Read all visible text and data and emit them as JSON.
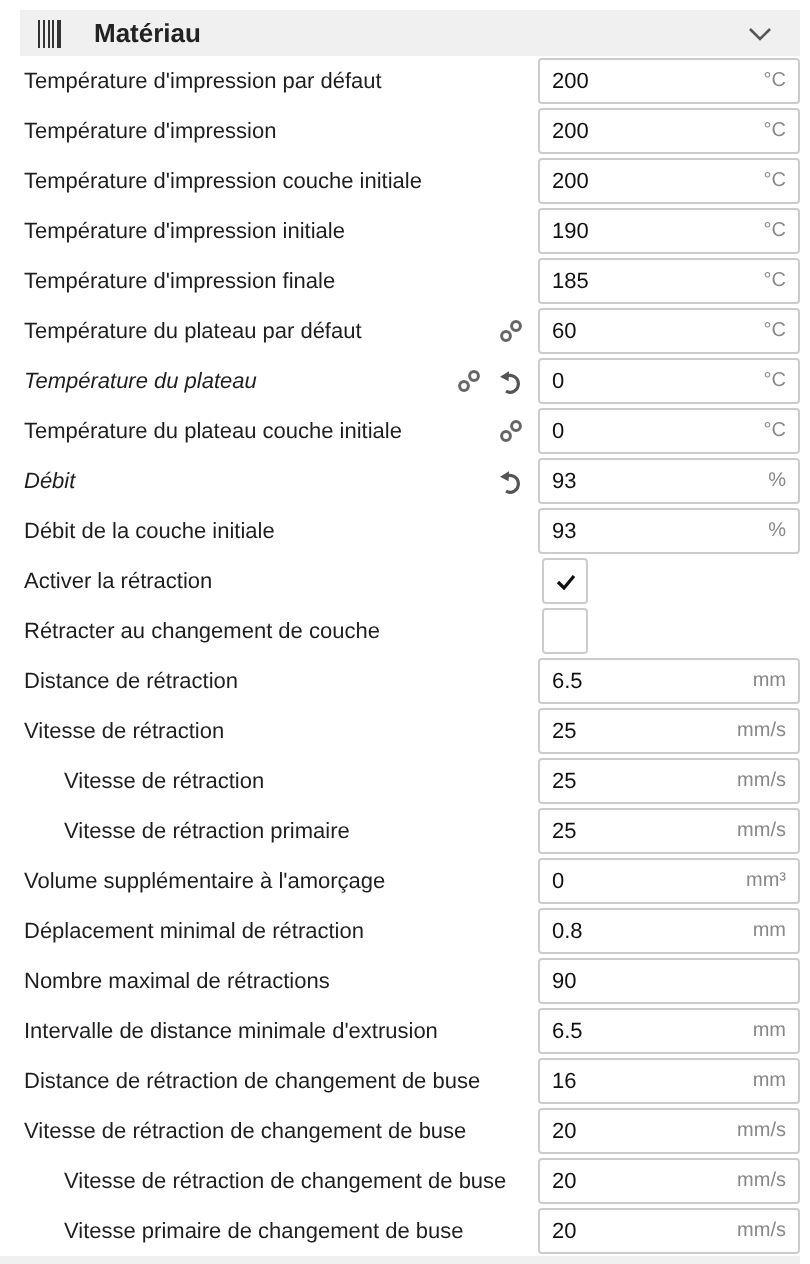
{
  "section": {
    "title": "Matériau",
    "expanded": true
  },
  "settings": [
    {
      "kind": "number",
      "label": "Température d'impression par défaut",
      "value": "200",
      "unit": "°C",
      "modified": false,
      "linked": false,
      "resettable": false
    },
    {
      "kind": "number",
      "label": "Température d'impression",
      "value": "200",
      "unit": "°C",
      "modified": false,
      "linked": false,
      "resettable": false
    },
    {
      "kind": "number",
      "label": "Température d'impression couche initiale",
      "value": "200",
      "unit": "°C",
      "modified": false,
      "linked": false,
      "resettable": false
    },
    {
      "kind": "number",
      "label": "Température d'impression initiale",
      "value": "190",
      "unit": "°C",
      "modified": false,
      "linked": false,
      "resettable": false
    },
    {
      "kind": "number",
      "label": "Température d'impression finale",
      "value": "185",
      "unit": "°C",
      "modified": false,
      "linked": false,
      "resettable": false
    },
    {
      "kind": "number",
      "label": "Température du plateau par défaut",
      "value": "60",
      "unit": "°C",
      "modified": false,
      "linked": true,
      "resettable": false
    },
    {
      "kind": "number",
      "label": "Température du plateau",
      "value": "0",
      "unit": "°C",
      "modified": true,
      "linked": true,
      "resettable": true
    },
    {
      "kind": "number",
      "label": "Température du plateau couche initiale",
      "value": "0",
      "unit": "°C",
      "modified": false,
      "linked": true,
      "resettable": false
    },
    {
      "kind": "number",
      "label": "Débit",
      "value": "93",
      "unit": "%",
      "modified": true,
      "linked": false,
      "resettable": true
    },
    {
      "kind": "number",
      "label": "Débit de la couche initiale",
      "value": "93",
      "unit": "%",
      "modified": false,
      "linked": false,
      "resettable": false
    },
    {
      "kind": "checkbox",
      "label": "Activer la rétraction",
      "checked": true,
      "modified": false,
      "linked": false,
      "resettable": false
    },
    {
      "kind": "checkbox",
      "label": "Rétracter au changement de couche",
      "checked": false,
      "modified": false,
      "linked": false,
      "resettable": false
    },
    {
      "kind": "number",
      "label": "Distance de rétraction",
      "value": "6.5",
      "unit": "mm",
      "modified": false,
      "linked": false,
      "resettable": false
    },
    {
      "kind": "number",
      "label": "Vitesse de rétraction",
      "value": "25",
      "unit": "mm/s",
      "modified": false,
      "linked": false,
      "resettable": false,
      "children": [
        {
          "kind": "number",
          "label": "Vitesse de rétraction",
          "value": "25",
          "unit": "mm/s",
          "modified": false,
          "linked": false,
          "resettable": false
        },
        {
          "kind": "number",
          "label": "Vitesse de rétraction primaire",
          "value": "25",
          "unit": "mm/s",
          "modified": false,
          "linked": false,
          "resettable": false
        }
      ]
    },
    {
      "kind": "number",
      "label": "Volume supplémentaire à l'amorçage",
      "value": "0",
      "unit": "mm³",
      "modified": false,
      "linked": false,
      "resettable": false
    },
    {
      "kind": "number",
      "label": "Déplacement minimal de rétraction",
      "value": "0.8",
      "unit": "mm",
      "modified": false,
      "linked": false,
      "resettable": false
    },
    {
      "kind": "number",
      "label": "Nombre maximal de rétractions",
      "value": "90",
      "modified": false,
      "linked": false,
      "resettable": false
    },
    {
      "kind": "number",
      "label": "Intervalle de distance minimale d'extrusion",
      "value": "6.5",
      "unit": "mm",
      "modified": false,
      "linked": false,
      "resettable": false
    },
    {
      "kind": "number",
      "label": "Distance de rétraction de changement de buse",
      "value": "16",
      "unit": "mm",
      "modified": false,
      "linked": false,
      "resettable": false
    },
    {
      "kind": "number",
      "label": "Vitesse de rétraction de changement de buse",
      "value": "20",
      "unit": "mm/s",
      "modified": false,
      "linked": false,
      "resettable": false,
      "children": [
        {
          "kind": "number",
          "label": "Vitesse de rétraction de changement de buse",
          "value": "20",
          "unit": "mm/s",
          "modified": false,
          "linked": false,
          "resettable": false
        },
        {
          "kind": "number",
          "label": "Vitesse primaire de changement de buse",
          "value": "20",
          "unit": "mm/s",
          "modified": false,
          "linked": false,
          "resettable": false
        }
      ]
    }
  ]
}
